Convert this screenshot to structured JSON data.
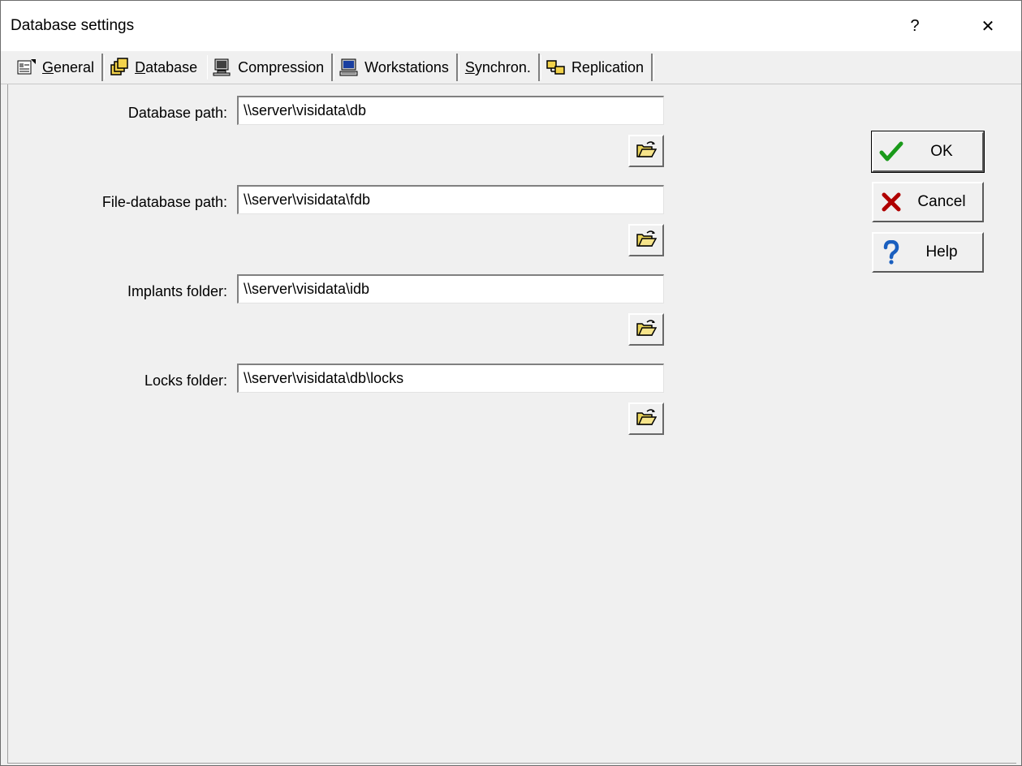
{
  "window": {
    "title": "Database settings",
    "help_glyph": "?",
    "close_glyph": "✕"
  },
  "tabs": [
    {
      "label": "General",
      "mnemonic": "G",
      "rest": "eneral",
      "icon": "properties-icon",
      "active": false
    },
    {
      "label": "Database",
      "mnemonic": "D",
      "rest": "atabase",
      "icon": "database-icon",
      "active": true
    },
    {
      "label": "Compression",
      "mnemonic": "",
      "rest": "Compression",
      "icon": "compression-icon",
      "active": false
    },
    {
      "label": "Workstations",
      "mnemonic": "",
      "rest": "Workstations",
      "icon": "workstation-icon",
      "active": false
    },
    {
      "label": "Synchron.",
      "mnemonic": "S",
      "rest": "ynchron.",
      "icon": "",
      "active": false
    },
    {
      "label": "Replication",
      "mnemonic": "",
      "rest": "Replication",
      "icon": "replication-icon",
      "active": false
    }
  ],
  "fields": [
    {
      "label": "Database path:",
      "value": "\\\\server\\visidata\\db"
    },
    {
      "label": "File-database path:",
      "value": "\\\\server\\visidata\\fdb"
    },
    {
      "label": "Implants folder:",
      "value": "\\\\server\\visidata\\idb"
    },
    {
      "label": "Locks folder:",
      "value": "\\\\server\\visidata\\db\\locks"
    }
  ],
  "buttons": {
    "ok": "OK",
    "cancel": "Cancel",
    "help": "Help"
  },
  "colors": {
    "ok_check": "#1a9a1a",
    "cancel_x": "#b00000",
    "help_q": "#1a5fbf",
    "folder": "#e8d35a"
  }
}
